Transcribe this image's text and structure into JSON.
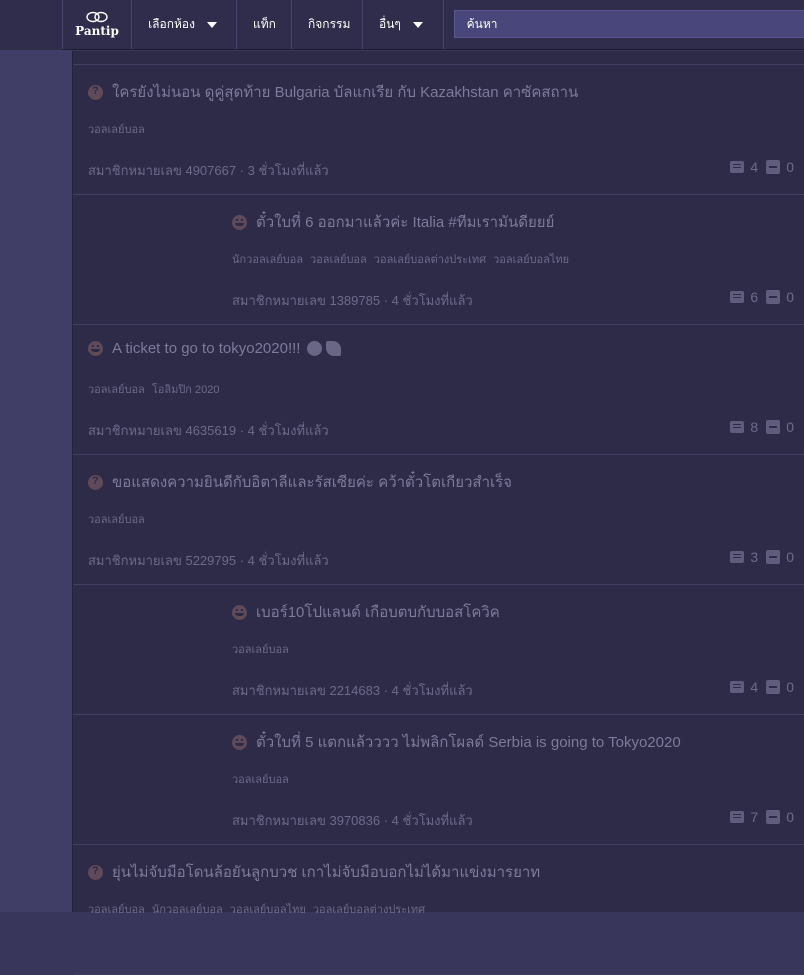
{
  "header": {
    "logo_text": "Pantip",
    "nav": [
      {
        "label": "เลือกห้อง",
        "has_caret": true
      },
      {
        "label": "แท็ก",
        "has_caret": false
      },
      {
        "label": "กิจกรรม",
        "has_caret": false
      },
      {
        "label": "อื่นๆ",
        "has_caret": true
      }
    ],
    "search_placeholder": "ค้นหา"
  },
  "topics": [
    {
      "title": "ใครยังไม่นอน ดูคู่สุดท้าย Bulgaria บัลแกเรีย กับ Kazakhstan คาซัคสถาน",
      "emoji": "thinking-face-icon",
      "indented": false,
      "tags": [
        "วอลเลย์บอล"
      ],
      "member": "สมาชิกหมายเลข 4907667",
      "time": "3 ชั่วโมงที่แล้ว",
      "comments": "4",
      "votes": "0"
    },
    {
      "title": "ตั๋วใบที่ 6 ออกมาแล้วค่ะ Italia #ทีมเรามันดียยย์",
      "emoji": "grinning-face-icon",
      "indented": true,
      "tags": [
        "นักวอลเลย์บอล",
        "วอลเลย์บอล",
        "วอลเลย์บอลต่างประเทศ",
        "วอลเลย์บอลไทย"
      ],
      "member": "สมาชิกหมายเลข 1389785",
      "time": "4 ชั่วโมงที่แล้ว",
      "comments": "6",
      "votes": "0"
    },
    {
      "title": "A ticket to go to tokyo2020!!!",
      "emoji": "grinning-face-icon",
      "indented": false,
      "has_flair": true,
      "tags": [
        "วอลเลย์บอล",
        "โอลิมปิก 2020"
      ],
      "member": "สมาชิกหมายเลข 4635619",
      "time": "4 ชั่วโมงที่แล้ว",
      "comments": "8",
      "votes": "0"
    },
    {
      "title": "ขอแสดงความยินดีกับอิตาลีและรัสเซียค่ะ คว้าตั๋วโตเกียวสำเร็จ",
      "emoji": "thinking-face-icon",
      "indented": false,
      "tags": [
        "วอลเลย์บอล"
      ],
      "member": "สมาชิกหมายเลข 5229795",
      "time": "4 ชั่วโมงที่แล้ว",
      "comments": "3",
      "votes": "0"
    },
    {
      "title": "เบอร์10โปแลนด์ เกือบตบกับบอสโควิค",
      "emoji": "grinning-face-icon",
      "indented": true,
      "tags": [
        "วอลเลย์บอล"
      ],
      "member": "สมาชิกหมายเลข 2214683",
      "time": "4 ชั่วโมงที่แล้ว",
      "comments": "4",
      "votes": "0"
    },
    {
      "title": "ตั๋วใบที่ 5 แตกแล้วววว ไม่พลิกโผลด์ Serbia is going to Tokyo2020",
      "emoji": "grinning-face-icon",
      "indented": true,
      "tags": [
        "วอลเลย์บอล"
      ],
      "member": "สมาชิกหมายเลข 3970836",
      "time": "4 ชั่วโมงที่แล้ว",
      "comments": "7",
      "votes": "0"
    },
    {
      "title": "ยุ่นไม่จับมือโดนล้อยันลูกบวช เกาไม่จับมือบอกไม่ได้มาแข่งมารยาท",
      "emoji": "thinking-face-icon",
      "indented": false,
      "tags": [
        "วอลเลย์บอล",
        "นักวอลเลย์บอล",
        "วอลเลย์บอลไทย",
        "วอลเลย์บอลต่างประเทศ"
      ],
      "member": "",
      "time": "",
      "comments": "",
      "votes": ""
    }
  ]
}
